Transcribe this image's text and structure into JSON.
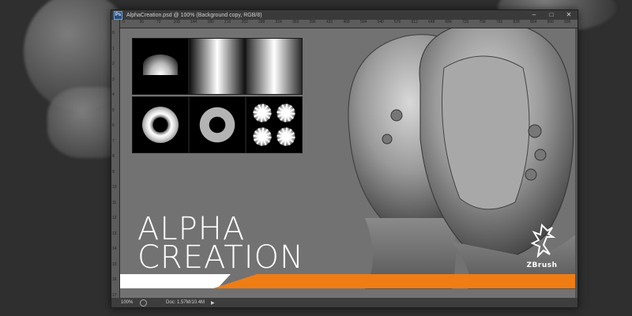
{
  "window": {
    "title": "AlphaCreation.psd @ 100% (Background copy, RGB/8)",
    "app_icon_label": "Ps",
    "controls": {
      "minimize": "–",
      "maximize": "□",
      "close": "✕"
    }
  },
  "ruler": {
    "top_ticks": [
      "0",
      "36",
      "72",
      "108",
      "144",
      "180",
      "216",
      "252",
      "288",
      "324",
      "360",
      "396",
      "432",
      "468",
      "504",
      "540",
      "576",
      "612",
      "648",
      "684",
      "720",
      "756",
      "792",
      "828",
      "864",
      "900",
      "936"
    ],
    "left_ticks": [
      "0",
      "1",
      "2",
      "3",
      "4",
      "5",
      "6",
      "7",
      "8",
      "9",
      "10",
      "11",
      "12",
      "13",
      "14",
      "15",
      "16",
      "17"
    ]
  },
  "canvas": {
    "headline_line1": "Alpha",
    "headline_line2": "Creation",
    "logo_text": "ZBrush",
    "accent_colors": {
      "orange": "#f07c14",
      "white": "#ffffff",
      "canvas_bg": "#727272"
    }
  },
  "alpha_tiles": [
    {
      "name": "cone-falloff"
    },
    {
      "name": "linear-gradient-soft"
    },
    {
      "name": "linear-gradient-hard"
    },
    {
      "name": "ring-beveled"
    },
    {
      "name": "ring-flat"
    },
    {
      "name": "flower-pattern"
    }
  ],
  "statusbar": {
    "zoom": "100%",
    "doc_info": "Doc: 1.57M/10.4M",
    "nav_arrow": "▶"
  }
}
